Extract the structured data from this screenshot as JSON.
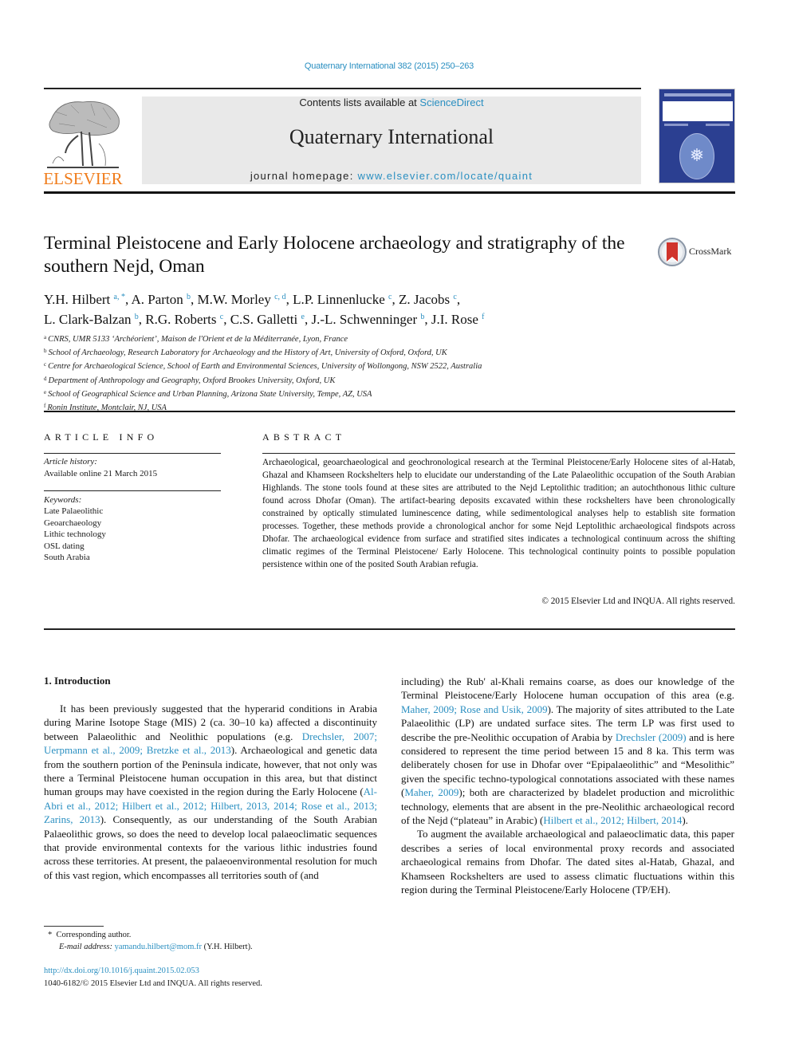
{
  "header": {
    "journal_ref": "Quaternary International 382 (2015) 250–263",
    "contents_prefix": "Contents lists available at ",
    "contents_link": "ScienceDirect",
    "journal_title": "Quaternary International",
    "homepage_prefix": "journal homepage: ",
    "homepage_link": "www.elsevier.com/locate/quaint",
    "publisher_logo_text": "ELSEVIER",
    "publisher_logo_icon": "elsevier-tree-icon",
    "cover_icon": "journal-cover-thumbnail"
  },
  "article": {
    "title": "Terminal Pleistocene and Early Holocene archaeology and stratigraphy of the southern Nejd, Oman",
    "crossmark_label": "CrossMark",
    "authors": [
      {
        "name": "Y.H. Hilbert",
        "sup": "a, *",
        "sep": ", "
      },
      {
        "name": "A. Parton",
        "sup": "b",
        "sep": ", "
      },
      {
        "name": "M.W. Morley",
        "sup": "c, d",
        "sep": ", "
      },
      {
        "name": "L.P. Linnenlucke",
        "sup": "c",
        "sep": ", "
      },
      {
        "name": "Z. Jacobs",
        "sup": "c",
        "sep": ","
      },
      {
        "name": "L. Clark-Balzan",
        "sup": "b",
        "sep": ", "
      },
      {
        "name": "R.G. Roberts",
        "sup": "c",
        "sep": ", "
      },
      {
        "name": "C.S. Galletti",
        "sup": "e",
        "sep": ", "
      },
      {
        "name": "J.-L. Schwenninger",
        "sup": "b",
        "sep": ", "
      },
      {
        "name": "J.I. Rose",
        "sup": "f",
        "sep": ""
      }
    ],
    "affiliations": [
      {
        "key": "a",
        "text": "CNRS, UMR 5133 ‘Archéorient’, Maison de l'Orient et de la Méditerranée, Lyon, France"
      },
      {
        "key": "b",
        "text": "School of Archaeology, Research Laboratory for Archaeology and the History of Art, University of Oxford, Oxford, UK"
      },
      {
        "key": "c",
        "text": "Centre for Archaeological Science, School of Earth and Environmental Sciences, University of Wollongong, NSW 2522, Australia"
      },
      {
        "key": "d",
        "text": "Department of Anthropology and Geography, Oxford Brookes University, Oxford, UK"
      },
      {
        "key": "e",
        "text": "School of Geographical Science and Urban Planning, Arizona State University, Tempe, AZ, USA"
      },
      {
        "key": "f",
        "text": "Ronin Institute, Montclair, NJ, USA"
      }
    ]
  },
  "article_info": {
    "heading": "ARTICLE INFO",
    "history_label": "Article history:",
    "history_value": "Available online 21 March 2015",
    "keywords_label": "Keywords:",
    "keywords": [
      "Late Palaeolithic",
      "Geoarchaeology",
      "Lithic technology",
      "OSL dating",
      "South Arabia"
    ]
  },
  "abstract": {
    "heading": "ABSTRACT",
    "text": "Archaeological, geoarchaeological and geochronological research at the Terminal Pleistocene/Early Ho­locene sites of al-Hatab, Ghazal and Khamseen Rockshelters help to elucidate our understanding of the Late Palaeolithic occupation of the South Arabian Highlands. The stone tools found at these sites are attributed to the Nejd Leptolithic tradition; an autochthonous lithic culture found across Dhofar (Oman). The artifact-bearing deposits excavated within these rockshelters have been chronologically constrained by optically stimulated luminescence dating, while sedimentological analyses help to establish site formation processes. Together, these methods provide a chronological anchor for some Nejd Leptolithic archaeological findspots across Dhofar. The archaeological evidence from surface and stratified sites indicates a technological continuum across the shifting climatic regimes of the Terminal Pleistocene/ Early Holocene. This technological continuity points to possible population persistence within one of the posited South Arabian refugia.",
    "copyright": "© 2015 Elsevier Ltd and INQUA. All rights reserved."
  },
  "body": {
    "section_heading": "1.  Introduction",
    "left_p1": [
      {
        "t": "It has been previously suggested that the hyperarid conditions in Arabia during Marine Isotope Stage (MIS) 2 (ca. 30–10 ka) affected a discontinuity between Palaeolithic and Neolithic pop­ulations (e.g. "
      },
      {
        "link": "Drechsler, 2007; Uerpmann et al., 2009; Bretzke et al., 2013"
      },
      {
        "t": "). Archaeological and genetic data from the southern portion of the Peninsula indicate, however, that not only was there a Terminal Pleistocene human occupation in this area, but that distinct human groups may have coexisted in the region during the Early Holocene ("
      },
      {
        "link": "Al-Abri et al., 2012; Hilbert et al., 2012; Hilbert, 2013, 2014; Rose et al., 2013; Zarins, 2013"
      },
      {
        "t": "). Consequently, as our understanding of the South Arabian Palaeolithic grows, so does the need to develop local palaeoclimatic sequences that provide environmental con­texts for the various lithic industries found across these territories. At present, the palaeoenvironmental resolution for much of this vast region, which encompasses all territories south of (and"
      }
    ],
    "right_p1": [
      {
        "t": "including) the Rub' al-Khali remains coarse, as does our knowledge of the Terminal Pleistocene/Early Holocene human occupation of this area (e.g. "
      },
      {
        "link": "Maher, 2009; Rose and Usik, 2009"
      },
      {
        "t": "). The majority of sites attributed to the Late Palaeolithic (LP) are undated surface sites. The term LP was first used to describe the pre-Neolithic occupation of Arabia by "
      },
      {
        "link": "Drechsler (2009)"
      },
      {
        "t": " and is here considered to represent the time period between 15 and 8 ka. This term was deliberately chosen for use in Dhofar over “Epipalaeolithic” and “Mesolithic” given the specific techno-typological connotations associated with these names ("
      },
      {
        "link": "Maher, 2009"
      },
      {
        "t": "); both are characterized by bladelet production and microlithic technology, elements that are absent in the pre-Neolithic archaeological record of the Nejd (“plateau” in Arabic) ("
      },
      {
        "link": "Hilbert et al., 2012; Hilbert, 2014"
      },
      {
        "t": ")."
      }
    ],
    "right_p2": [
      {
        "t": "To augment the available archaeological and palaeoclimatic data, this paper describes a series of local environmental proxy records and associated archaeological remains from Dhofar. The dated sites al-Hatab, Ghazal, and Khamseen Rockshelters are used to assess climatic fluctuations within this region during the Ter­minal Pleistocene/Early Holocene (TP/EH)."
      }
    ]
  },
  "footnotes": {
    "marker": "*",
    "corresponding": "Corresponding author.",
    "email_label": "E-mail address: ",
    "email": "yamandu.hilbert@mom.fr",
    "email_suffix": " (Y.H. Hilbert).",
    "doi": "http://dx.doi.org/10.1016/j.quaint.2015.02.053",
    "issn_copyright": "1040-6182/© 2015 Elsevier Ltd and INQUA. All rights reserved."
  },
  "colors": {
    "link": "#2a8fc1",
    "elsevier_orange": "#f07c1b",
    "masthead_bg": "#e9e9e9",
    "cover_blue": "#2b3f91"
  }
}
